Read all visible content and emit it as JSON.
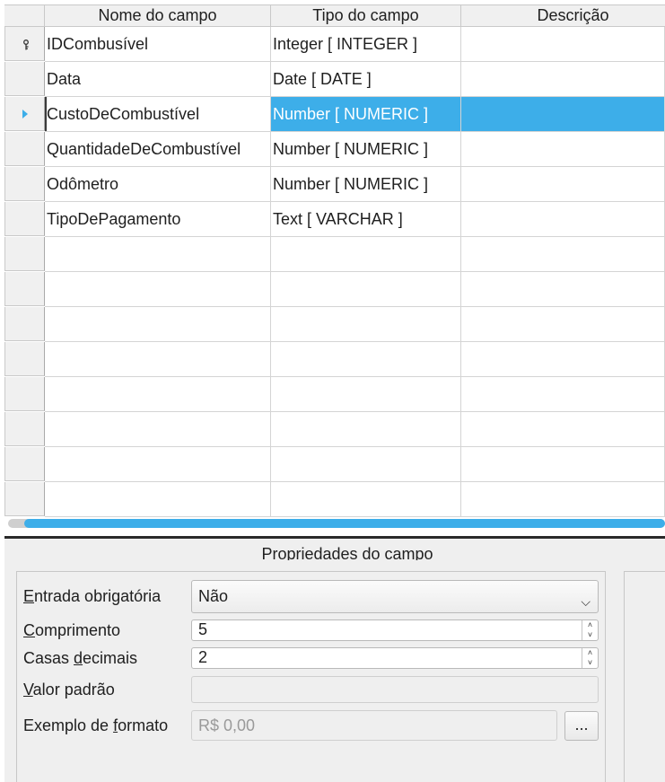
{
  "grid": {
    "columns": [
      "Nome do campo",
      "Tipo do campo",
      "Descrição"
    ],
    "rows": [
      {
        "name": "IDCombusível",
        "type": "Integer [ INTEGER ]",
        "description": "",
        "indicator": "key-icon"
      },
      {
        "name": "Data",
        "type": "Date [ DATE ]",
        "description": "",
        "indicator": ""
      },
      {
        "name": "CustoDeCombustível",
        "type": "Number [ NUMERIC ]",
        "description": "",
        "indicator": "arrow-icon",
        "selected": true
      },
      {
        "name": "QuantidadeDeCombustível",
        "type": "Number [ NUMERIC ]",
        "description": "",
        "indicator": ""
      },
      {
        "name": "Odômetro",
        "type": "Number [ NUMERIC ]",
        "description": "",
        "indicator": ""
      },
      {
        "name": "TipoDePagamento",
        "type": "Text [ VARCHAR ]",
        "description": "",
        "indicator": ""
      },
      {
        "name": "",
        "type": "",
        "description": "",
        "indicator": ""
      },
      {
        "name": "",
        "type": "",
        "description": "",
        "indicator": ""
      },
      {
        "name": "",
        "type": "",
        "description": "",
        "indicator": ""
      },
      {
        "name": "",
        "type": "",
        "description": "",
        "indicator": ""
      },
      {
        "name": "",
        "type": "",
        "description": "",
        "indicator": ""
      },
      {
        "name": "",
        "type": "",
        "description": "",
        "indicator": ""
      },
      {
        "name": "",
        "type": "",
        "description": "",
        "indicator": ""
      },
      {
        "name": "",
        "type": "",
        "description": "",
        "indicator": ""
      }
    ]
  },
  "properties": {
    "title": "Propriedades do campo",
    "required": {
      "label_pre": "",
      "label_u": "E",
      "label_post": "ntrada obrigatória",
      "value": "Não"
    },
    "length": {
      "label_pre": "",
      "label_u": "C",
      "label_post": "omprimento",
      "value": "5"
    },
    "decimals": {
      "label_pre": "Casas ",
      "label_u": "d",
      "label_post": "ecimais",
      "value": "2"
    },
    "default_value": {
      "label_pre": "",
      "label_u": "V",
      "label_post": "alor padrão",
      "value": ""
    },
    "format_example": {
      "label_pre": "Exemplo de ",
      "label_u": "f",
      "label_post": "ormato",
      "value": "R$ 0,00",
      "button": "..."
    }
  },
  "colors": {
    "accent": "#3daee9",
    "header_bg": "#f0f0f0",
    "panel_bg": "#efefef"
  }
}
